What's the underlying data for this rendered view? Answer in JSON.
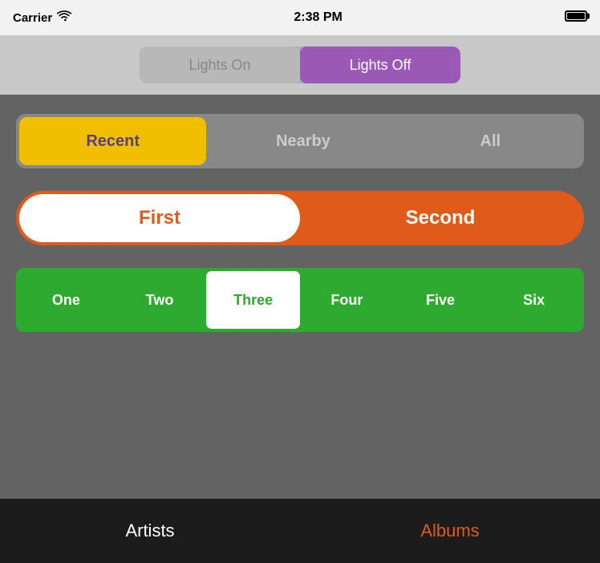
{
  "status_bar": {
    "carrier": "Carrier",
    "time": "2:38 PM"
  },
  "top_toggle": {
    "lights_on_label": "Lights On",
    "lights_off_label": "Lights Off",
    "active": "off"
  },
  "seg1": {
    "items": [
      {
        "label": "Recent",
        "active": true
      },
      {
        "label": "Nearby",
        "active": false
      },
      {
        "label": "All",
        "active": false
      }
    ]
  },
  "seg2": {
    "items": [
      {
        "label": "First",
        "active": true
      },
      {
        "label": "Second",
        "active": false
      }
    ]
  },
  "seg3": {
    "items": [
      {
        "label": "One",
        "active": false
      },
      {
        "label": "Two",
        "active": false
      },
      {
        "label": "Three",
        "active": true
      },
      {
        "label": "Four",
        "active": false
      },
      {
        "label": "Five",
        "active": false
      },
      {
        "label": "Six",
        "active": false
      }
    ]
  },
  "bottom_tabs": [
    {
      "label": "Artists",
      "active": false
    },
    {
      "label": "Albums",
      "active": true
    }
  ]
}
